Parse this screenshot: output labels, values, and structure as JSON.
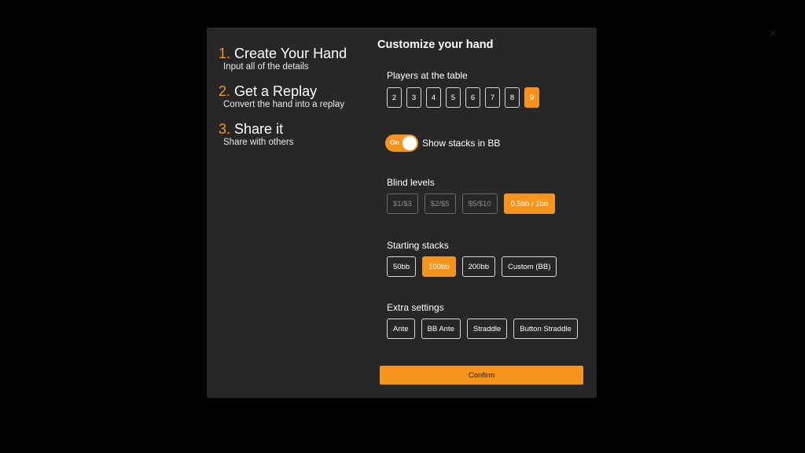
{
  "close_icon": "×",
  "steps": [
    {
      "num": "1.",
      "title": "Create Your Hand",
      "subtitle": "Input all of the details"
    },
    {
      "num": "2.",
      "title": "Get a Replay",
      "subtitle": "Convert the hand into a replay"
    },
    {
      "num": "3.",
      "title": "Share it",
      "subtitle": "Share with others"
    }
  ],
  "panel": {
    "title": "Customize your hand",
    "players": {
      "label": "Players at the table",
      "options": [
        "2",
        "3",
        "4",
        "5",
        "6",
        "7",
        "8",
        "9"
      ],
      "selected": "9"
    },
    "show_stacks": {
      "toggle_text": "On",
      "label": "Show stacks in BB",
      "on": true
    },
    "blinds": {
      "label": "Blind levels",
      "options": [
        "$1/$3",
        "$2/$5",
        "$5/$10",
        "0.5bb / 1bb"
      ],
      "selected": "0.5bb / 1bb"
    },
    "stacks": {
      "label": "Starting stacks",
      "options": [
        "50bb",
        "100bb",
        "200bb",
        "Custom (BB)"
      ],
      "selected": "100bb"
    },
    "extra": {
      "label": "Extra settings",
      "options": [
        "Ante",
        "BB Ante",
        "Straddle",
        "Button Straddle"
      ]
    },
    "confirm_label": "Confirm"
  },
  "colors": {
    "accent": "#f7941d",
    "modal_bg": "#272727",
    "page_bg": "#000000"
  }
}
